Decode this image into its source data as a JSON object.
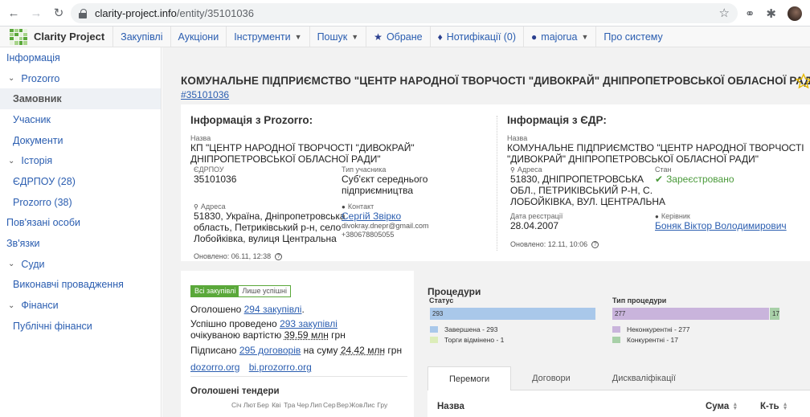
{
  "browser": {
    "url_host": "clarity-project.info",
    "url_path": "/entity/35101036"
  },
  "nav": {
    "brand": "Clarity Project",
    "items": [
      {
        "label": "Закупівлі"
      },
      {
        "label": "Аукціони"
      },
      {
        "label": "Інструменти"
      },
      {
        "label": "Пошук"
      },
      {
        "label": "Обране"
      },
      {
        "label": "Нотифікації (0)"
      },
      {
        "label": "majorua"
      },
      {
        "label": "Про систему"
      }
    ]
  },
  "sidebar": {
    "items": [
      {
        "label": "Інформація"
      },
      {
        "label": "Prozorro"
      },
      {
        "label": "Замовник"
      },
      {
        "label": "Учасник"
      },
      {
        "label": "Документи"
      },
      {
        "label": "Історія"
      },
      {
        "label": "ЄДРПОУ (28)"
      },
      {
        "label": "Prozorro (38)"
      },
      {
        "label": "Пов'язані особи"
      },
      {
        "label": "Зв'язки"
      },
      {
        "label": "Суди"
      },
      {
        "label": "Виконавчі провадження"
      },
      {
        "label": "Фінанси"
      },
      {
        "label": "Публічні фінанси"
      }
    ]
  },
  "entity": {
    "title": "КОМУНАЛЬНЕ ПІДПРИЄМСТВО \"ЦЕНТР НАРОДНОЇ ТВОРЧОСТІ \"ДИВОКРАЙ\" ДНІПРОПЕТРОВСЬКОЇ ОБЛАСНОЇ РАДИ\"",
    "edrpou_link": "#35101036"
  },
  "prozorro": {
    "heading": "Інформація з Prozorro:",
    "name_label": "Назва",
    "name_line1": "КП \"ЦЕНТР НАРОДНОЇ ТВОРЧОСТІ \"ДИВОКРАЙ\"",
    "name_line2": "ДНІПРОПЕТРОВСЬКОЇ ОБЛАСНОЇ РАДИ\"",
    "edrpou_label": "ЄДРПОУ",
    "edrpou_value": "35101036",
    "type_label": "Тип учасника",
    "type_line1": "Суб'єкт середнього",
    "type_line2": "підприємництва",
    "address_label": "Адреса",
    "address_line1": "51830, Україна, Дніпропетровська",
    "address_line2": "область, Петриківський р-н, село",
    "address_line3": "Лобойківка, вулиця Центральна",
    "contact_label": "Контакт",
    "contact_name": "Сергій Звірко",
    "contact_email": "divokray.dnepr@gmail.com",
    "contact_phone": "+380678805055",
    "updated": "Оновлено: 06.11, 12:38"
  },
  "edr": {
    "heading": "Інформація з ЄДР:",
    "name_label": "Назва",
    "name_line1": "КОМУНАЛЬНЕ ПІДПРИЄМСТВО \"ЦЕНТР НАРОДНОЇ ТВОРЧОСТІ",
    "name_line2": "\"ДИВОКРАЙ\" ДНІПРОПЕТРОВСЬКОЇ ОБЛАСНОЇ РАДИ\"",
    "address_label": "Адреса",
    "address_line1": "51830, ДНІПРОПЕТРОВСЬКА",
    "address_line2": "ОБЛ., ПЕТРИКІВСЬКИЙ Р-Н, С.",
    "address_line3": "ЛОБОЙКІВКА, ВУЛ. ЦЕНТРАЛЬНА",
    "state_label": "Стан",
    "state_value": "Зареєстровано",
    "reg_date_label": "Дата реєстрації",
    "reg_date_value": "28.04.2007",
    "head_label": "Керівник",
    "head_value": "Боняк Віктор Володимирович",
    "updated": "Оновлено: 12.11, 10:06"
  },
  "stats": {
    "toggle_all": "Всі закупівлі",
    "toggle_success": "Лише успішні",
    "announced_prefix": "Оголошено ",
    "announced_link": "294 закупівлі",
    "announced_suffix": ".",
    "success_prefix": "Успішно проведено ",
    "success_link": "293 закупівлі",
    "success_mid": "очікуваною вартістю ",
    "success_value": "39.59 млн",
    "success_currency": " грн",
    "signed_prefix": "Підписано ",
    "signed_link": "295 договорів",
    "signed_mid": " на суму ",
    "signed_value": "24.42 млн",
    "signed_currency": " грн",
    "link_dozorro": "dozorro.org",
    "link_bi": "bi.prozorro.org",
    "tenders_title": "Оголошені тендери",
    "months": [
      "Січ",
      "Лют",
      "Бер",
      "Кві",
      "Тра",
      "Чер",
      "Лип",
      "Сер",
      "Вер",
      "Жов",
      "Лис",
      "Гру"
    ]
  },
  "procedures": {
    "title": "Процедури",
    "status_label": "Статус",
    "status_bar_value": "293",
    "status_legend": [
      {
        "label": "Завершена - 293",
        "color": "#a9c8ea",
        "value": 293
      },
      {
        "label": "Торги відмінено - 1",
        "color": "#dcedb9",
        "value": 1
      }
    ],
    "type_label": "Тип процедури",
    "type_bar_a": "277",
    "type_bar_b": "17",
    "type_legend": [
      {
        "label": "Неконкурентні - 277",
        "color": "#c9b4dc",
        "value": 277
      },
      {
        "label": "Конкурентні - 17",
        "color": "#a8d0a8",
        "value": 17
      }
    ]
  },
  "tabs": {
    "items": [
      {
        "label": "Перемоги"
      },
      {
        "label": "Договори"
      },
      {
        "label": "Дискваліфікації"
      }
    ],
    "col_name": "Назва",
    "col_sum": "Сума",
    "col_count": "К-ть"
  }
}
